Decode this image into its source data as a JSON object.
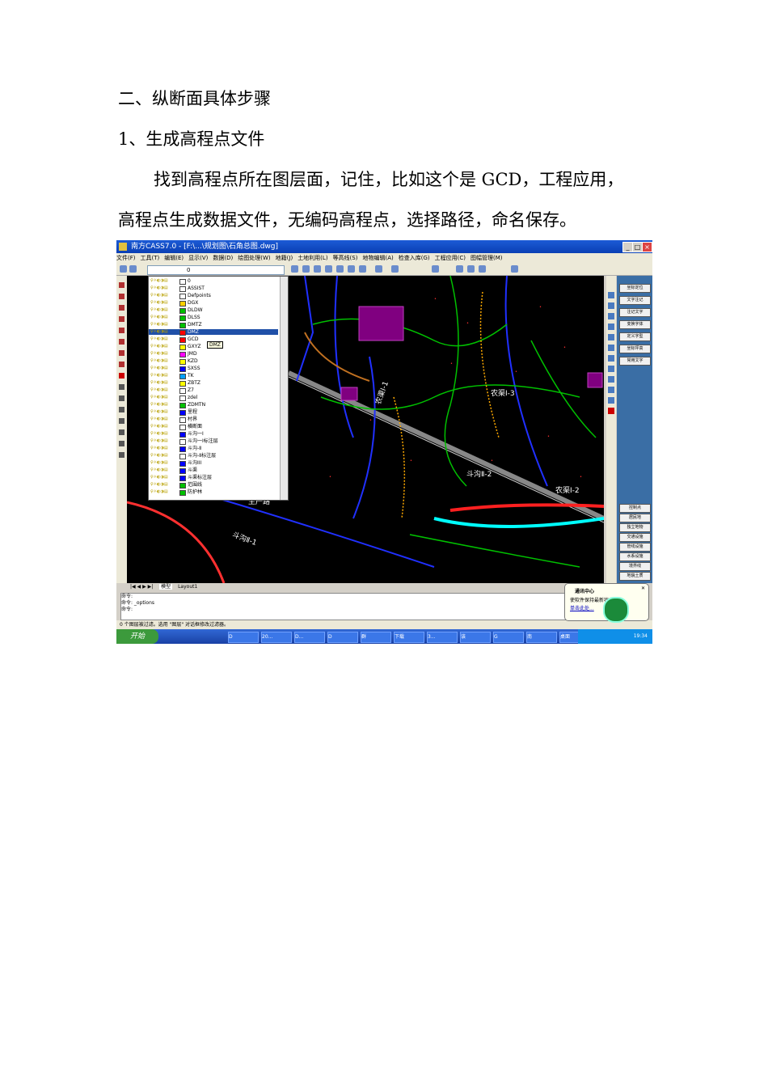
{
  "document": {
    "heading": "二、纵断面具体步骤",
    "step": "1、生成高程点文件",
    "body_line1": "找到高程点所在图层面，记住，比如这个是 GCD，工程应用，",
    "body_line2": "高程点生成数据文件，无编码高程点，选择路径，命名保存。"
  },
  "screenshot": {
    "title": "南方CASS7.0 - [F:\\...\\规划图\\石角总图.dwg]",
    "menu": [
      "文件(F)",
      "工具(T)",
      "编辑(E)",
      "显示(V)",
      "数据(D)",
      "绘图处理(W)",
      "地籍(J)",
      "土地利用(L)",
      "等高线(S)",
      "地物编辑(A)",
      "检查入库(G)",
      "工程应用(C)",
      "图幅管理(M)"
    ],
    "layer_combo_value": "0",
    "layers": [
      "0",
      "ASSIST",
      "Defpoints",
      "DGX",
      "DLDW",
      "DLSS",
      "DMTZ",
      "DMZ",
      "GCD",
      "GXYZ",
      "JMD",
      "KZD",
      "SXSS",
      "TK",
      "ZBTZ",
      "Z7",
      "zdel",
      "ZDMTN",
      "里程",
      "村界",
      "横断面",
      "斗沟一Ⅰ",
      "斗沟一Ⅰ标注层",
      "斗沟-Ⅱ",
      "斗沟-Ⅱ标注层",
      "斗沟III",
      "斗渠",
      "斗渠标注层",
      "范围线",
      "防护林"
    ],
    "selected_layer": "DMZ",
    "tooltip": "DMZ",
    "right_panel_top": [
      "坐标定位",
      "文字注记",
      "注记文字",
      "变换字体",
      "定义字型",
      "坐标坪高",
      "常用文字"
    ],
    "right_panel_bottom": [
      "控制点",
      "居民地",
      "独立地物",
      "交通设施",
      "管线设施",
      "水系设施",
      "境界线",
      "地貌土质"
    ],
    "map_labels": [
      "农渠Ⅰ-1",
      "农渠Ⅰ-3",
      "斗沟Ⅱ-2",
      "农渠Ⅰ-2",
      "斗沟Ⅱ-1",
      "生产路"
    ],
    "layout_tabs": [
      "模型",
      "Layout1"
    ],
    "command_lines": [
      "命令:",
      "命令:  _options",
      "命令:"
    ],
    "status_text": "0 个图层被过滤。选用 \"图层\" 对话框修改过滤器。",
    "start_button": "开始",
    "tasks": [
      "D",
      "20...",
      "D...",
      "D",
      "群",
      "下载",
      "3...",
      "该",
      "G",
      "南",
      "桌面"
    ],
    "balloon_title": "通讯中心",
    "balloon_message": "使软件保持最新状态...",
    "balloon_link": "单击此处...",
    "clock": "19:34"
  }
}
